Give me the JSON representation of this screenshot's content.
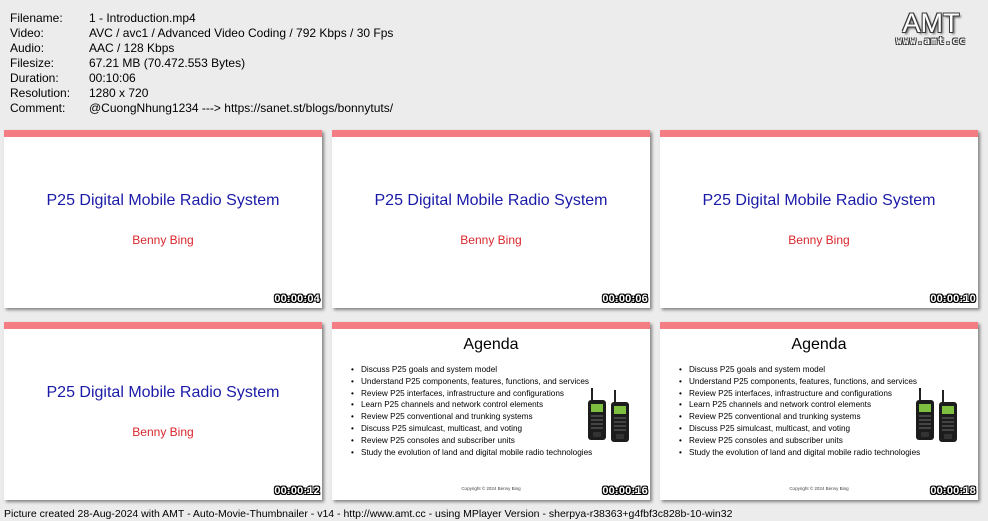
{
  "info": [
    {
      "key": "Filename:",
      "value": "1 - Introduction.mp4"
    },
    {
      "key": "Video:",
      "value": "AVC / avc1 / Advanced Video Coding / 792 Kbps / 30 Fps"
    },
    {
      "key": "Audio:",
      "value": "AAC / 128 Kbps"
    },
    {
      "key": "Filesize:",
      "value": "67.21 MB (70.472.553 Bytes)"
    },
    {
      "key": "Duration:",
      "value": "00:10:06"
    },
    {
      "key": "Resolution:",
      "value": "1280 x 720"
    },
    {
      "key": "Comment:",
      "value": "@CuongNhung1234 ---> https://sanet.st/blogs/bonnytuts/"
    }
  ],
  "logo": {
    "text": "AMT",
    "url": "www.amt.cc"
  },
  "slides": {
    "title": "P25 Digital Mobile Radio System",
    "author": "Benny Bing",
    "agenda_title": "Agenda",
    "agenda_items": [
      "Discuss P25 goals and system model",
      "Understand P25 components, features, functions, and services",
      "Review P25 interfaces, infrastructure and configurations",
      "Learn P25 channels and network control elements",
      "Review P25 conventional and trunking systems",
      "Discuss P25 simulcast, multicast, and voting",
      "Review P25 consoles and subscriber units",
      "Study the evolution of land and digital mobile radio technologies"
    ],
    "copyright": "Copyright © 2024 Benny Bing"
  },
  "thumbnails": [
    {
      "type": "title",
      "timestamp": "00:00:04"
    },
    {
      "type": "title",
      "timestamp": "00:00:06"
    },
    {
      "type": "title",
      "timestamp": "00:00:10"
    },
    {
      "type": "title",
      "timestamp": "00:00:12"
    },
    {
      "type": "agenda",
      "timestamp": "00:00:16"
    },
    {
      "type": "agenda",
      "timestamp": "00:00:18"
    }
  ],
  "colors": {
    "accent_bar": "#f47d84",
    "slide_title": "#1a1aa8",
    "slide_author": "#d8262c"
  },
  "footer": "Picture created 28-Aug-2024 with AMT - Auto-Movie-Thumbnailer - v14 - http://www.amt.cc - using MPlayer Version - sherpya-r38363+g4fbf3c828b-10-win32"
}
